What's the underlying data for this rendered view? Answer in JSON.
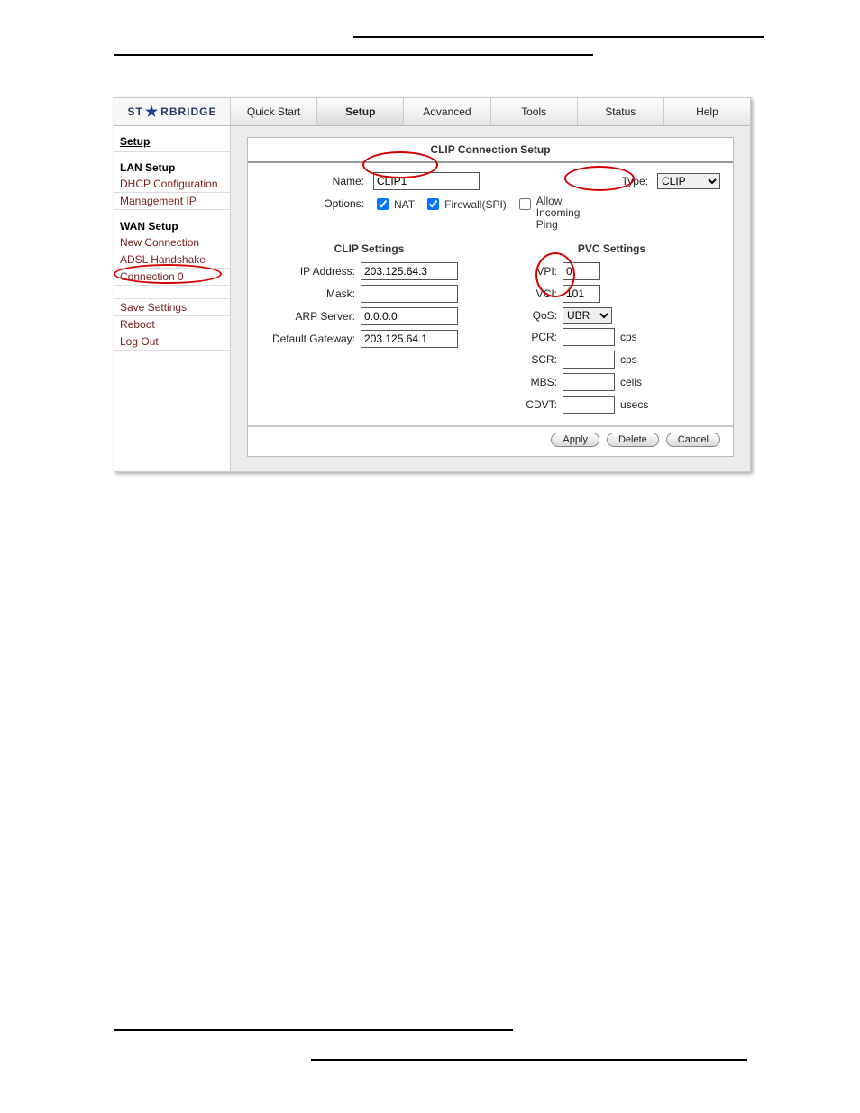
{
  "logo_text_left": "ST",
  "logo_text_right": "RBRIDGE",
  "tabs": [
    "Quick Start",
    "Setup",
    "Advanced",
    "Tools",
    "Status",
    "Help"
  ],
  "active_tab_index": 1,
  "sidebar": {
    "title": "Setup",
    "lan_label": "LAN Setup",
    "lan_items": [
      "DHCP Configuration",
      "Management IP"
    ],
    "wan_label": "WAN Setup",
    "wan_items": [
      "New Connection",
      "ADSL Handshake",
      "Connection 0"
    ],
    "bottom_items": [
      "Save Settings",
      "Reboot",
      "Log Out"
    ]
  },
  "panel": {
    "title": "CLIP Connection Setup",
    "name_label": "Name:",
    "name_value": "CLIP1",
    "type_label": "Type:",
    "type_value": "CLIP",
    "options_label": "Options:",
    "nat_label": "NAT",
    "firewall_label": "Firewall(SPI)",
    "allow_ping_label": "Allow\nIncoming\nPing",
    "clip": {
      "title": "CLIP Settings",
      "ip_label": "IP Address:",
      "ip_value": "203.125.64.3",
      "mask_label": "Mask:",
      "mask_value": "",
      "arp_label": "ARP Server:",
      "arp_value": "0.0.0.0",
      "gw_label": "Default Gateway:",
      "gw_value": "203.125.64.1"
    },
    "pvc": {
      "title": "PVC Settings",
      "vpi_label": "VPI:",
      "vpi_value": "0",
      "vci_label": "VCI:",
      "vci_value": "101",
      "qos_label": "QoS:",
      "qos_value": "UBR",
      "pcr_label": "PCR:",
      "pcr_value": "",
      "pcr_unit": "cps",
      "scr_label": "SCR:",
      "scr_value": "",
      "scr_unit": "cps",
      "mbs_label": "MBS:",
      "mbs_value": "",
      "mbs_unit": "cells",
      "cdvt_label": "CDVT:",
      "cdvt_value": "",
      "cdvt_unit": "usecs"
    },
    "buttons": {
      "apply": "Apply",
      "delete": "Delete",
      "cancel": "Cancel"
    }
  }
}
